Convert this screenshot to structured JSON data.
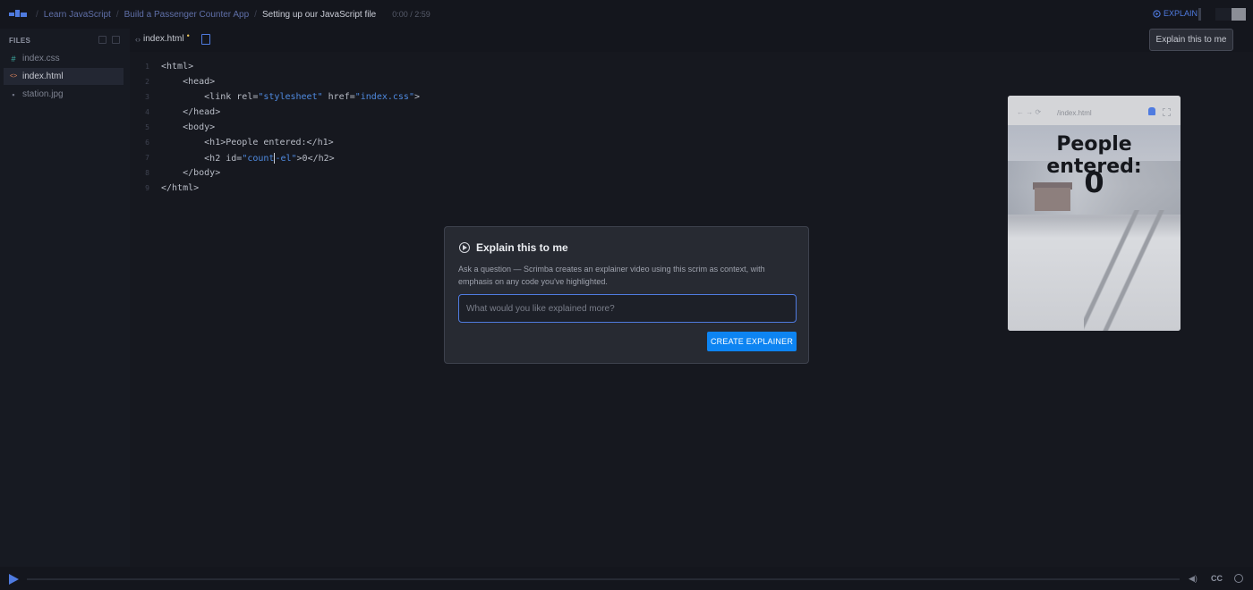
{
  "breadcrumbs": [
    "Learn JavaScript",
    "Build a Passenger Counter App",
    "Setting up our JavaScript file"
  ],
  "time": "0:00 / 2:59",
  "explain_link": "EXPLAIN",
  "tooltip": "Explain this to me",
  "sidebar": {
    "header": "FILES",
    "files": [
      {
        "icon": "#",
        "name": "index.css"
      },
      {
        "icon": "<>",
        "name": "index.html"
      },
      {
        "icon": "▪",
        "name": "station.jpg"
      }
    ]
  },
  "tab": {
    "name": "index.html",
    "modified": "•"
  },
  "code": {
    "line_numbers": [
      "1",
      "2",
      "3",
      "4",
      "5",
      "6",
      "7",
      "8",
      "9"
    ],
    "l1": "<html>",
    "l2": "    <head>",
    "l3a": "        <link rel=",
    "l3b": "\"stylesheet\"",
    "l3c": " href=",
    "l3d": "\"index.css\"",
    "l3e": ">",
    "l4": "    </head>",
    "l5": "    <body>",
    "l6": "        <h1>People entered:</h1>",
    "l7a": "        <h2 id=",
    "l7b": "\"count",
    "l7c": "-el\"",
    "l7d": ">0</h2>",
    "l8": "    </body>",
    "l9": "</html>"
  },
  "preview": {
    "url": "/index.html",
    "h1": "People entered:",
    "h2": "0"
  },
  "modal": {
    "title": "Explain this to me",
    "description": "Ask a question — Scrimba creates an explainer video using this scrim as context, with emphasis on any code you've highlighted.",
    "placeholder": "What would you like explained more?",
    "button": "CREATE EXPLAINER"
  },
  "player": {
    "cc": "CC"
  },
  "colors": {
    "accent": "#4f7be0",
    "button": "#0d84f2",
    "background": "#14161d"
  }
}
